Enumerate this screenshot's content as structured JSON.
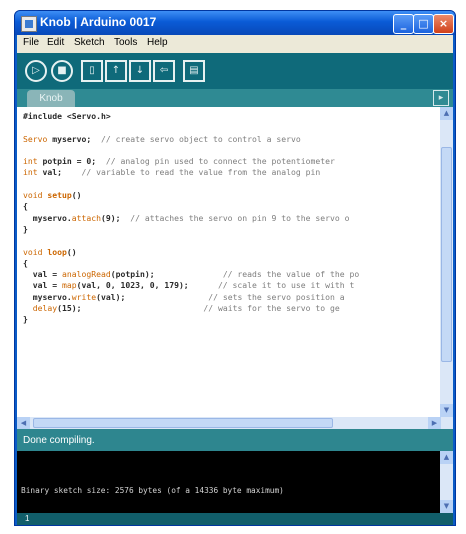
{
  "window": {
    "title": "Knob | Arduino 0017"
  },
  "menu": [
    "File",
    "Edit",
    "Sketch",
    "Tools",
    "Help"
  ],
  "toolbar_icons": [
    "run-icon",
    "stop-icon",
    "new-icon",
    "open-icon",
    "save-icon",
    "upload-icon",
    "serial-monitor-icon"
  ],
  "tab": {
    "label": "Knob"
  },
  "code": {
    "include": "#include <Servo.h>",
    "l2_type": "Servo",
    "l2_var": " myservo;",
    "l2_comment": "  // create servo object to control a servo",
    "l3_type": "int",
    "l3_code": " potpin = 0;",
    "l3_comment": "  // analog pin used to connect the potentiometer",
    "l4_type": "int",
    "l4_code": " val;",
    "l4_comment": "    // variable to read the value from the analog pin",
    "setup_type": "void",
    "setup_name": " setup",
    "setup_parens": "()",
    "brace_open": "{",
    "attach_obj": "  myservo.",
    "attach_fn": "attach",
    "attach_args": "(9);",
    "attach_comment": "  // attaches the servo on pin 9 to the servo o",
    "brace_close": "}",
    "loop_type": "void",
    "loop_name": " loop",
    "loop_parens": "()",
    "read_pre": "  val = ",
    "read_fn": "analogRead",
    "read_args": "(potpin);",
    "read_comment": "// reads the value of the po",
    "map_pre": "  val = ",
    "map_fn": "map",
    "map_args": "(val, 0, 1023, 0, 179);",
    "map_comment": "// scale it to use it with t",
    "write_obj": "  myservo.",
    "write_fn": "write",
    "write_args": "(val);",
    "write_comment": "// sets the servo position a",
    "delay_fn": "delay",
    "delay_args": "(15);",
    "delay_comment": "// waits for the servo to ge"
  },
  "status": {
    "message": "Done compiling."
  },
  "console": {
    "output": "Binary sketch size: 2576 bytes (of a 14336 byte maximum)"
  },
  "footer": {
    "line_number": "1"
  }
}
